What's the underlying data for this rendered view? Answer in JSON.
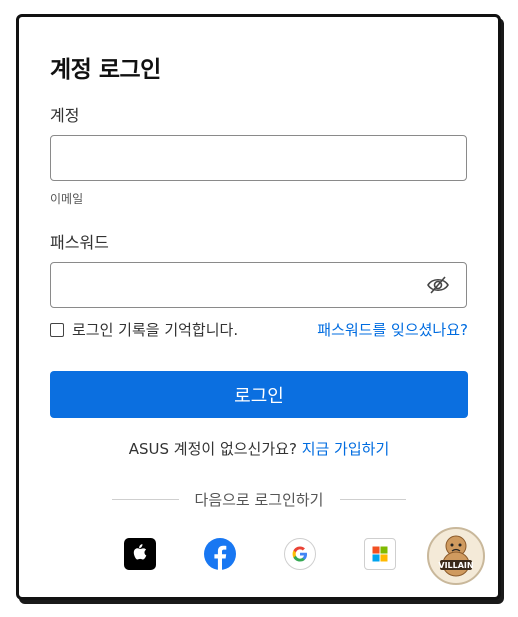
{
  "login": {
    "title": "계정 로그인",
    "account_label": "계정",
    "account_value": "",
    "account_hint": "이메일",
    "password_label": "패스워드",
    "password_value": "",
    "remember_label": "로그인 기록을 기억합니다.",
    "remember_checked": false,
    "forgot_link": "패스워드를 잊으셨나요?",
    "submit_label": "로그인",
    "no_account_text": "ASUS 계정이 없으신가요?",
    "signup_link": "지금 가입하기",
    "alt_login_text": "다음으로 로그인하기"
  },
  "social_logins": [
    {
      "name": "apple-icon"
    },
    {
      "name": "facebook-icon"
    },
    {
      "name": "google-icon"
    },
    {
      "name": "microsoft-icon"
    }
  ],
  "colors": {
    "primary": "#0b6fe0",
    "link": "#006ce0",
    "facebook": "#1877f2"
  },
  "watermark": {
    "text": "VILLAIN"
  }
}
